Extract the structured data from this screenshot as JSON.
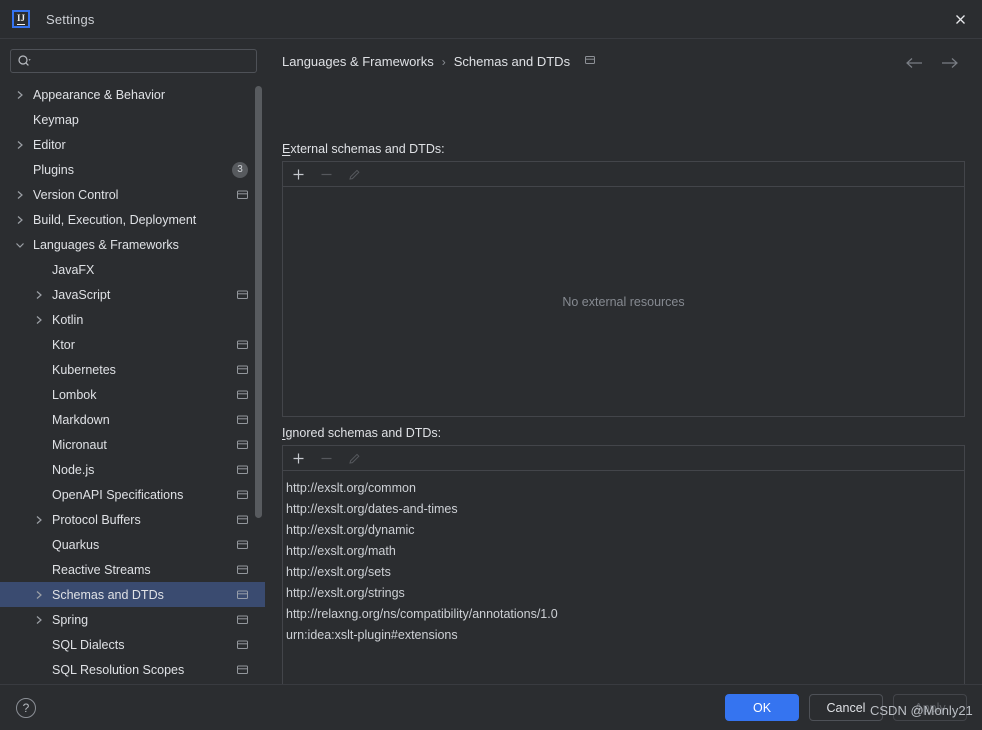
{
  "window": {
    "title": "Settings",
    "logo_text": "IJ",
    "close_icon": "close-icon"
  },
  "search": {
    "value": "",
    "placeholder": "",
    "icon": "search-icon"
  },
  "sidebar": {
    "items": [
      {
        "label": "Appearance & Behavior",
        "level": 0,
        "arrow": "collapsed",
        "badge": "",
        "module": false,
        "selected": false
      },
      {
        "label": "Keymap",
        "level": 0,
        "arrow": "none",
        "badge": "",
        "module": false,
        "selected": false
      },
      {
        "label": "Editor",
        "level": 0,
        "arrow": "collapsed",
        "badge": "",
        "module": false,
        "selected": false
      },
      {
        "label": "Plugins",
        "level": 0,
        "arrow": "none",
        "badge": "3",
        "module": false,
        "selected": false
      },
      {
        "label": "Version Control",
        "level": 0,
        "arrow": "collapsed",
        "badge": "",
        "module": true,
        "selected": false
      },
      {
        "label": "Build, Execution, Deployment",
        "level": 0,
        "arrow": "collapsed",
        "badge": "",
        "module": false,
        "selected": false
      },
      {
        "label": "Languages & Frameworks",
        "level": 0,
        "arrow": "expanded",
        "badge": "",
        "module": false,
        "selected": false
      },
      {
        "label": "JavaFX",
        "level": 1,
        "arrow": "none",
        "badge": "",
        "module": false,
        "selected": false
      },
      {
        "label": "JavaScript",
        "level": 1,
        "arrow": "collapsed",
        "badge": "",
        "module": true,
        "selected": false
      },
      {
        "label": "Kotlin",
        "level": 1,
        "arrow": "collapsed",
        "badge": "",
        "module": false,
        "selected": false
      },
      {
        "label": "Ktor",
        "level": 1,
        "arrow": "none",
        "badge": "",
        "module": true,
        "selected": false
      },
      {
        "label": "Kubernetes",
        "level": 1,
        "arrow": "none",
        "badge": "",
        "module": true,
        "selected": false
      },
      {
        "label": "Lombok",
        "level": 1,
        "arrow": "none",
        "badge": "",
        "module": true,
        "selected": false
      },
      {
        "label": "Markdown",
        "level": 1,
        "arrow": "none",
        "badge": "",
        "module": true,
        "selected": false
      },
      {
        "label": "Micronaut",
        "level": 1,
        "arrow": "none",
        "badge": "",
        "module": true,
        "selected": false
      },
      {
        "label": "Node.js",
        "level": 1,
        "arrow": "none",
        "badge": "",
        "module": true,
        "selected": false
      },
      {
        "label": "OpenAPI Specifications",
        "level": 1,
        "arrow": "none",
        "badge": "",
        "module": true,
        "selected": false
      },
      {
        "label": "Protocol Buffers",
        "level": 1,
        "arrow": "collapsed",
        "badge": "",
        "module": true,
        "selected": false
      },
      {
        "label": "Quarkus",
        "level": 1,
        "arrow": "none",
        "badge": "",
        "module": true,
        "selected": false
      },
      {
        "label": "Reactive Streams",
        "level": 1,
        "arrow": "none",
        "badge": "",
        "module": true,
        "selected": false
      },
      {
        "label": "Schemas and DTDs",
        "level": 1,
        "arrow": "collapsed",
        "badge": "",
        "module": true,
        "selected": true
      },
      {
        "label": "Spring",
        "level": 1,
        "arrow": "collapsed",
        "badge": "",
        "module": true,
        "selected": false
      },
      {
        "label": "SQL Dialects",
        "level": 1,
        "arrow": "none",
        "badge": "",
        "module": true,
        "selected": false
      },
      {
        "label": "SQL Resolution Scopes",
        "level": 1,
        "arrow": "none",
        "badge": "",
        "module": true,
        "selected": false
      }
    ]
  },
  "main": {
    "breadcrumb": {
      "root": "Languages & Frameworks",
      "separator": "›",
      "current": "Schemas and DTDs",
      "module_icon": "module-icon"
    },
    "nav": {
      "back_icon": "arrow-left-icon",
      "forward_icon": "arrow-right-icon"
    },
    "external": {
      "label_mnemonic": "E",
      "label_rest": "xternal schemas and DTDs:",
      "toolbar": {
        "add": "add-icon",
        "remove": "remove-icon",
        "edit": "edit-icon"
      },
      "empty_text": "No external resources",
      "items": []
    },
    "ignored": {
      "label_mnemonic": "I",
      "label_rest": "gnored schemas and DTDs:",
      "toolbar": {
        "add": "add-icon",
        "remove": "remove-icon",
        "edit": "edit-icon"
      },
      "items": [
        "http://exslt.org/common",
        "http://exslt.org/dates-and-times",
        "http://exslt.org/dynamic",
        "http://exslt.org/math",
        "http://exslt.org/sets",
        "http://exslt.org/strings",
        "http://relaxng.org/ns/compatibility/annotations/1.0",
        "urn:idea:xslt-plugin#extensions"
      ]
    }
  },
  "footer": {
    "help_label": "?",
    "ok_label": "OK",
    "cancel_label": "Cancel",
    "apply_label": "Apply"
  },
  "watermark": {
    "text": "CSDN @Monly21"
  },
  "colors": {
    "accent": "#3574f0",
    "selection": "#3a4b70",
    "background": "#2b2d30",
    "border": "#43454a",
    "text": "#dfe1e5",
    "muted": "#868a91"
  }
}
